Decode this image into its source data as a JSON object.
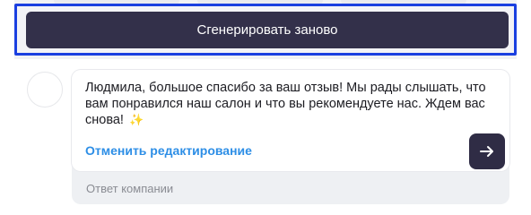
{
  "actions": {
    "regenerate_label": "Сгенерировать заново"
  },
  "reply": {
    "text": "Людмила, большое спасибо за ваш отзыв! Мы рады слышать, что вам понравился наш салон и что вы рекомендуете нас. Ждем вас снова!",
    "emoji": "✨",
    "cancel_edit_label": "Отменить редактирование",
    "send_icon": "arrow-right-icon"
  },
  "company_answer": {
    "label": "Ответ компании"
  },
  "colors": {
    "button_dark": "#33304a",
    "link_blue": "#2d8ee6",
    "highlight_blue": "#1a3fe0"
  }
}
